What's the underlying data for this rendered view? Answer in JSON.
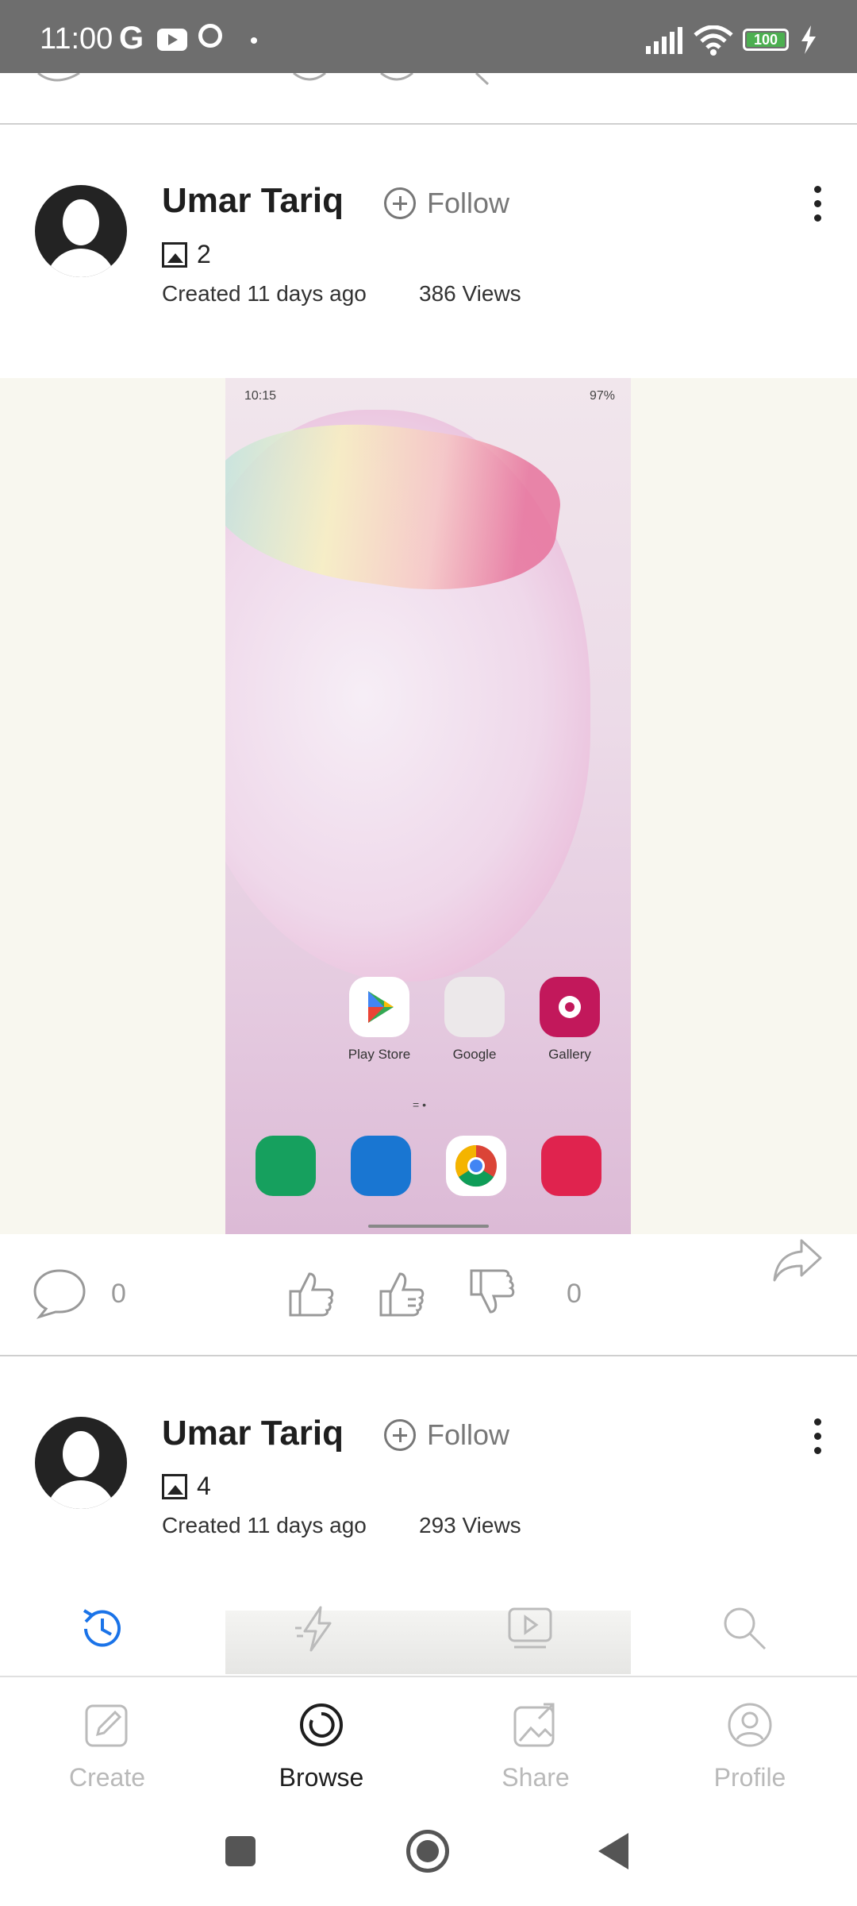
{
  "status_bar": {
    "time": "11:00",
    "carrier_icon": "G",
    "battery": "100"
  },
  "posts": [
    {
      "author": "Umar Tariq",
      "follow_label": "Follow",
      "image_count": "2",
      "created": "Created 11 days ago",
      "views": "386 Views",
      "comments": "0",
      "votes": "0",
      "screenshot": {
        "time": "10:15",
        "status_right": "97%",
        "apps": [
          "Play Store",
          "Google",
          "Gallery"
        ]
      }
    },
    {
      "author": "Umar Tariq",
      "follow_label": "Follow",
      "image_count": "4",
      "created": "Created 11 days ago",
      "views": "293 Views"
    }
  ],
  "floating_tabs": [
    "history-icon",
    "lightning-icon",
    "video-icon",
    "search-icon"
  ],
  "bottom_nav": [
    {
      "label": "Create",
      "icon": "pencil-icon",
      "active": false
    },
    {
      "label": "Browse",
      "icon": "browse-icon",
      "active": true
    },
    {
      "label": "Share",
      "icon": "share-image-icon",
      "active": false
    },
    {
      "label": "Profile",
      "icon": "profile-icon",
      "active": false
    }
  ],
  "colors": {
    "accent": "#1a73e8",
    "status_bar": "#6e6e6e",
    "media_bg": "#f8f7ef"
  }
}
